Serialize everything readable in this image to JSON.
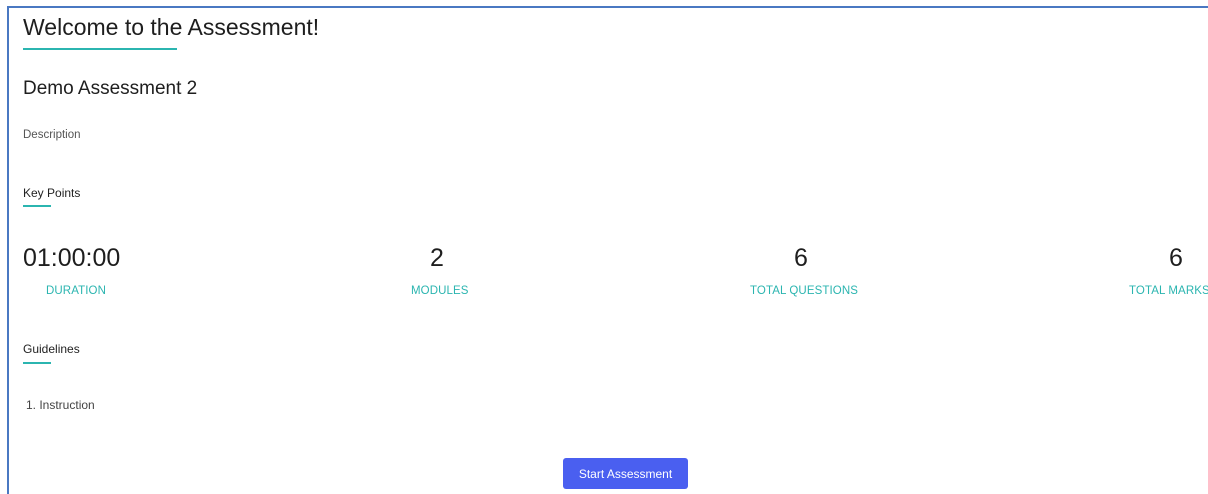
{
  "header": {
    "title": "Welcome to the Assessment!"
  },
  "assessment": {
    "name": "Demo Assessment 2",
    "description": "Description"
  },
  "key_points": {
    "heading": "Key Points",
    "stats": [
      {
        "value": "01:00:00",
        "label": "DURATION"
      },
      {
        "value": "2",
        "label": "MODULES"
      },
      {
        "value": "6",
        "label": "TOTAL QUESTIONS"
      },
      {
        "value": "6",
        "label": "TOTAL MARKS"
      }
    ]
  },
  "guidelines": {
    "heading": "Guidelines",
    "items": [
      "1. Instruction"
    ]
  },
  "actions": {
    "start_label": "Start Assessment"
  },
  "colors": {
    "accent": "#2bb5b0",
    "primary_button": "#4a5ff0",
    "frame_border": "#4a78c2"
  }
}
